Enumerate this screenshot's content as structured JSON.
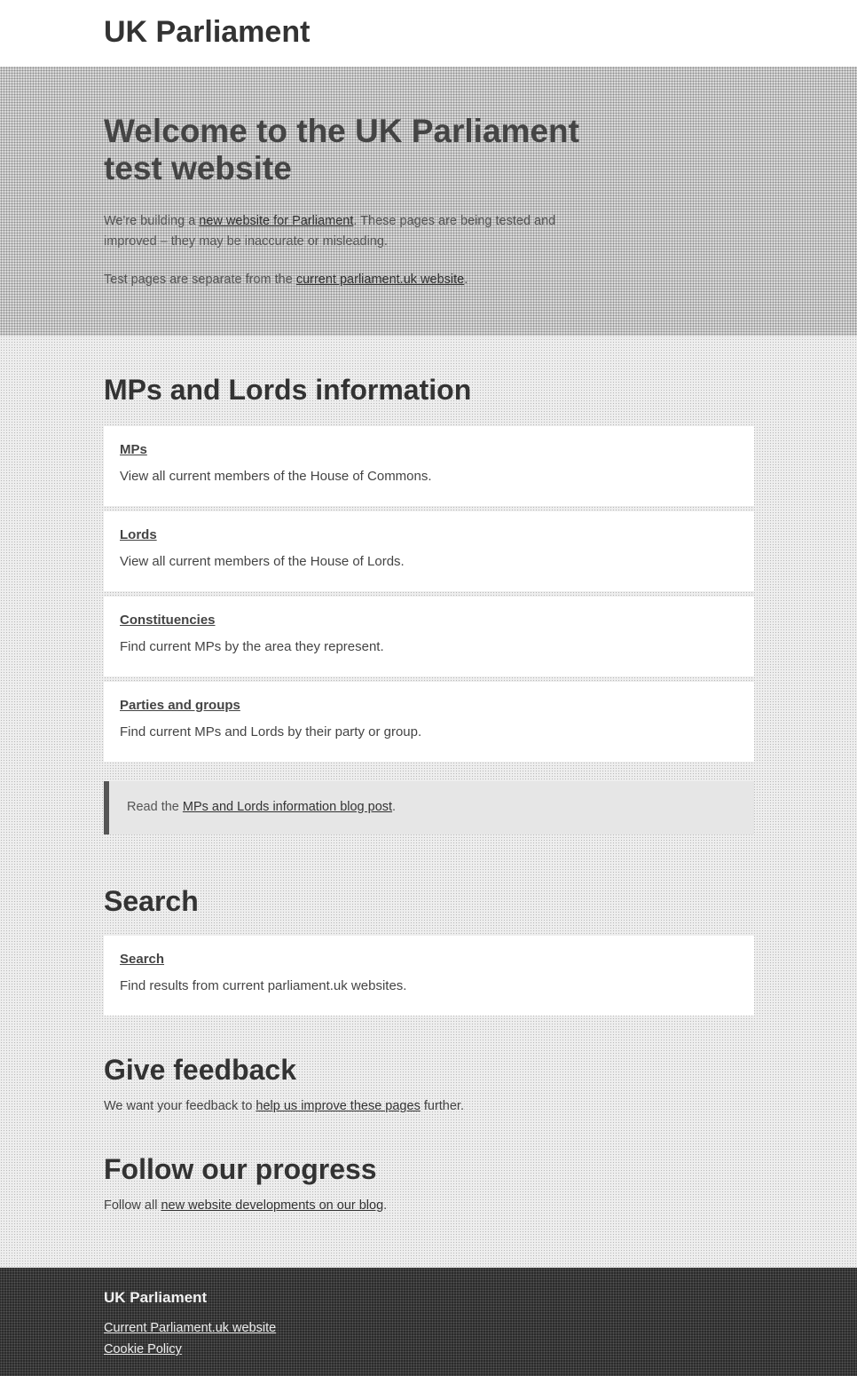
{
  "header": {
    "title": "UK Parliament"
  },
  "hero": {
    "title": "Welcome to the UK Parliament test website",
    "p1_before": "We're building a ",
    "p1_link": "new website for Parliament",
    "p1_after": ". These pages are being tested and improved – they may be inaccurate or misleading.",
    "p2_before": "Test pages are separate from the ",
    "p2_link": "current parliament.uk website",
    "p2_after": "."
  },
  "mps_section": {
    "title": "MPs and Lords information",
    "cards": [
      {
        "link": "MPs",
        "desc": "View all current members of the House of Commons."
      },
      {
        "link": "Lords",
        "desc": "View all current members of the House of Lords."
      },
      {
        "link": "Constituencies",
        "desc": "Find current MPs by the area they represent."
      },
      {
        "link": "Parties and groups",
        "desc": "Find current MPs and Lords by their party or group."
      }
    ],
    "callout_before": "Read the ",
    "callout_link": "MPs and Lords information blog post",
    "callout_after": "."
  },
  "search_section": {
    "title": "Search",
    "cards": [
      {
        "link": "Search",
        "desc": "Find results from current parliament.uk websites."
      }
    ]
  },
  "feedback_section": {
    "title": "Give feedback",
    "before": "We want your feedback to ",
    "link": "help us improve these pages",
    "after": " further."
  },
  "progress_section": {
    "title": "Follow our progress",
    "before": "Follow all ",
    "link": "new website developments on our blog",
    "after": "."
  },
  "footer": {
    "title": "UK Parliament",
    "links": [
      "Current Parliament.uk website",
      "Cookie Policy"
    ]
  }
}
